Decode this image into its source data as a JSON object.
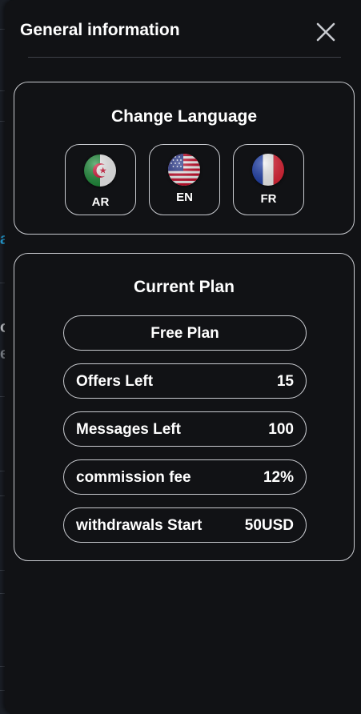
{
  "panel": {
    "title": "General information",
    "close_icon": "close-icon"
  },
  "background": {
    "fragments": [
      "a",
      "o",
      "e"
    ]
  },
  "language": {
    "title": "Change Language",
    "options": [
      {
        "code": "AR",
        "flag": "algeria-flag-icon"
      },
      {
        "code": "EN",
        "flag": "usa-flag-icon"
      },
      {
        "code": "FR",
        "flag": "france-flag-icon"
      }
    ]
  },
  "plan": {
    "title": "Current Plan",
    "name": "Free Plan",
    "rows": [
      {
        "label": "Offers Left",
        "value": "15"
      },
      {
        "label": "Messages Left",
        "value": "100"
      },
      {
        "label": "commission fee",
        "value": "12%"
      },
      {
        "label": "withdrawals Start",
        "value": "50USD"
      }
    ]
  },
  "colors": {
    "panel_bg": "#111215",
    "border": "#c9cbd0",
    "text": "#ffffff",
    "accent_fragment": "#2aa7e0"
  }
}
